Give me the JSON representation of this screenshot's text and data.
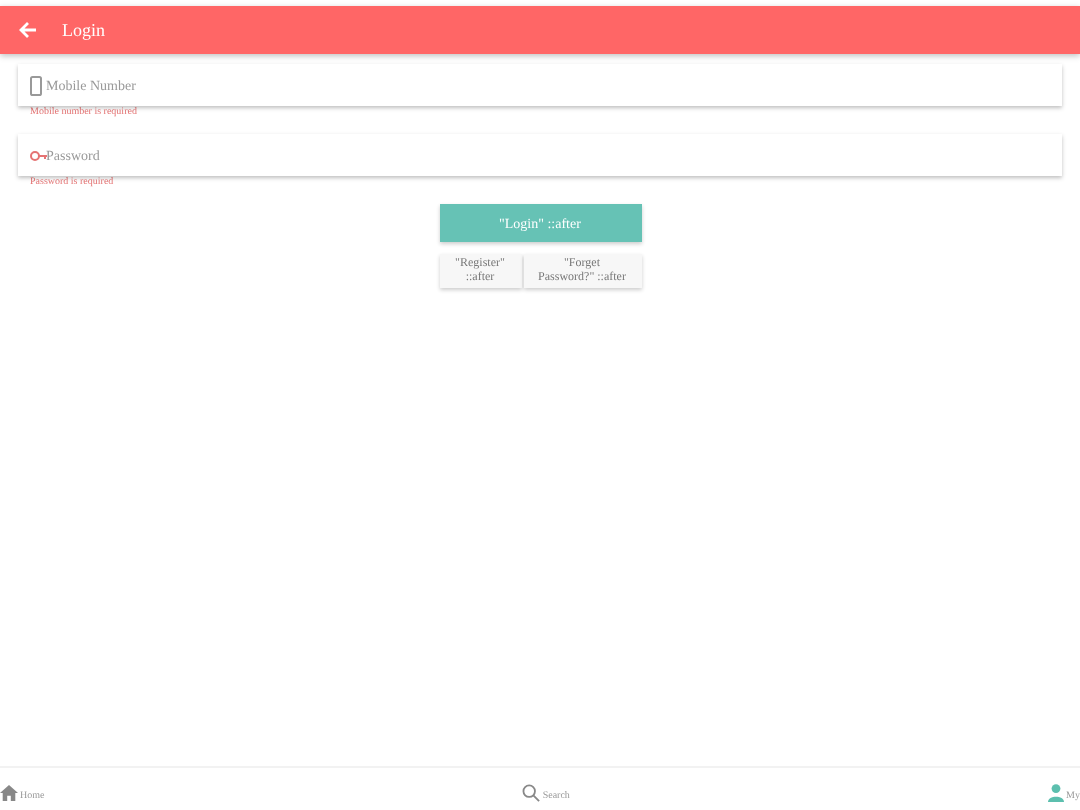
{
  "header": {
    "title": "Login"
  },
  "fields": [
    {
      "kind": "phone",
      "placeholder": "Mobile Number",
      "error": "Mobile number is required"
    },
    {
      "kind": "key",
      "placeholder": "Password",
      "error": "Password is required"
    }
  ],
  "login_button": "\"Login\" ::after",
  "links": [
    "\"Register\" ::after",
    "\"Forget Password?\" ::after"
  ],
  "nav": [
    {
      "kind": "home",
      "label": "Home",
      "selected": false
    },
    {
      "kind": "search",
      "label": "Search",
      "selected": false
    },
    {
      "kind": "user",
      "label": "My",
      "selected": true
    }
  ]
}
